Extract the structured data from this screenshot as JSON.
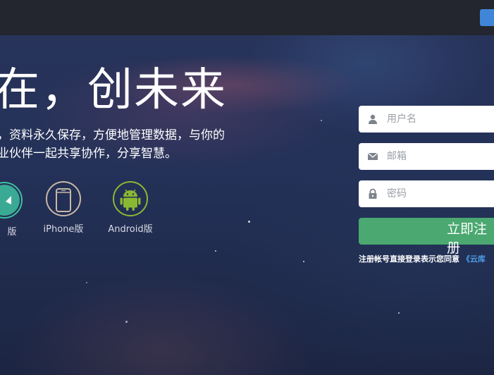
{
  "hero": {
    "headline": "在，创未来",
    "description": [
      "，资料永久保存，方便地管理数据，与你的",
      "业伙伴一起共享协作，分享智慧。"
    ],
    "platforms": [
      {
        "label": "版",
        "icon": "android-pad-icon",
        "color": "#3ec0a0"
      },
      {
        "label": "iPhone版",
        "icon": "iphone-icon",
        "color": "#c8b8a6"
      },
      {
        "label": "Android版",
        "icon": "android-robot-icon",
        "color": "#8ab832"
      }
    ]
  },
  "form": {
    "username_placeholder": "用户名",
    "email_placeholder": "邮箱",
    "password_placeholder": "密码",
    "register_label": "立即注册",
    "agree_text": "注册帐号直接登录表示您同意 ",
    "agree_link": "《云库"
  },
  "colors": {
    "topbar": "#23262e",
    "accent_blue": "#3f86d9",
    "register_green": "#4aa870",
    "link_blue": "#4d9be6"
  }
}
